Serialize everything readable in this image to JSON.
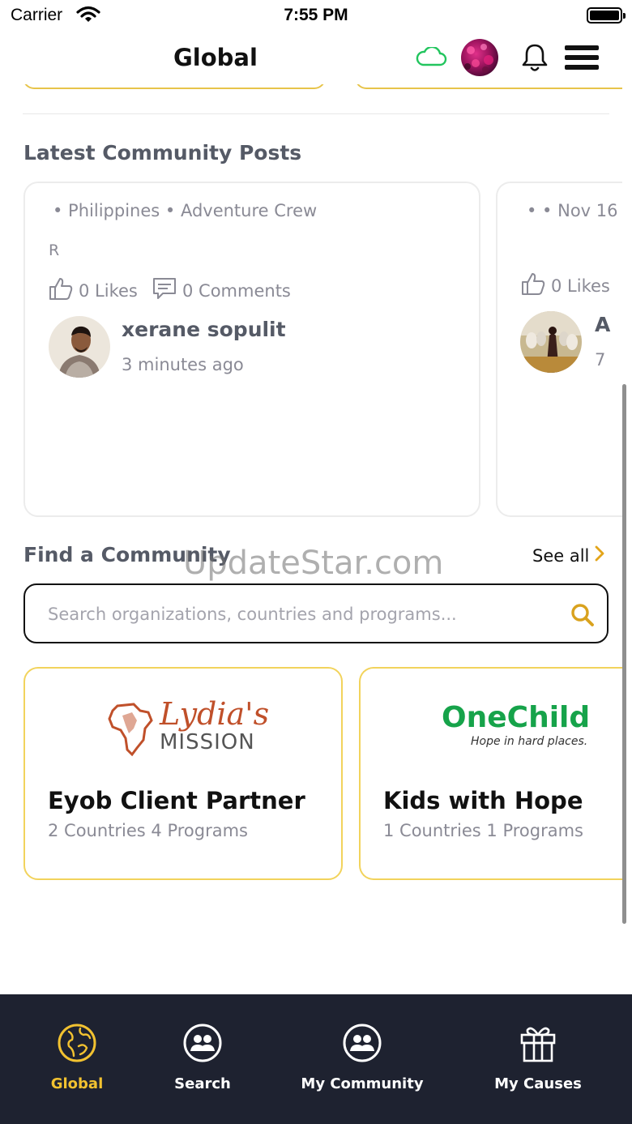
{
  "status_bar": {
    "carrier": "Carrier",
    "time": "7:55 PM"
  },
  "header": {
    "title": "Global"
  },
  "latest_posts": {
    "title": "Latest Community Posts",
    "posts": [
      {
        "meta": "• Philippines • Adventure Crew",
        "body": "R",
        "likes": "0 Likes",
        "comments": "0 Comments",
        "author": "xerane sopulit",
        "time": "3 minutes ago"
      },
      {
        "meta": "•  • Nov 16",
        "likes": "0 Likes",
        "author": "A",
        "time": "7"
      }
    ]
  },
  "find_community": {
    "title": "Find a Community",
    "see_all": "See all",
    "watermark": "UpdateStar.com",
    "search_placeholder": "Search organizations, countries and programs...",
    "orgs": [
      {
        "logo_script": "Lydia's",
        "logo_caps": "MISSION",
        "name": "Eyob Client Partner",
        "stats": "2 Countries 4 Programs"
      },
      {
        "logo_main": "OneChild",
        "logo_tagline": "Hope in hard places.",
        "name": "Kids with Hope",
        "stats": "1 Countries 1 Programs"
      }
    ]
  },
  "bottom_nav": {
    "items": [
      {
        "label": "Global",
        "icon": "globe-icon",
        "active": true
      },
      {
        "label": "Search",
        "icon": "people-icon",
        "active": false
      },
      {
        "label": "My Community",
        "icon": "people-icon",
        "active": false
      },
      {
        "label": "My Causes",
        "icon": "gift-icon",
        "active": false
      }
    ]
  },
  "colors": {
    "accent": "#f2c230",
    "nav_bg": "#1e2230",
    "card_border_gold": "#f2d35c",
    "cloud_green": "#22c55e",
    "onechild_green": "#16a34a",
    "lydia_orange": "#c0502a"
  }
}
